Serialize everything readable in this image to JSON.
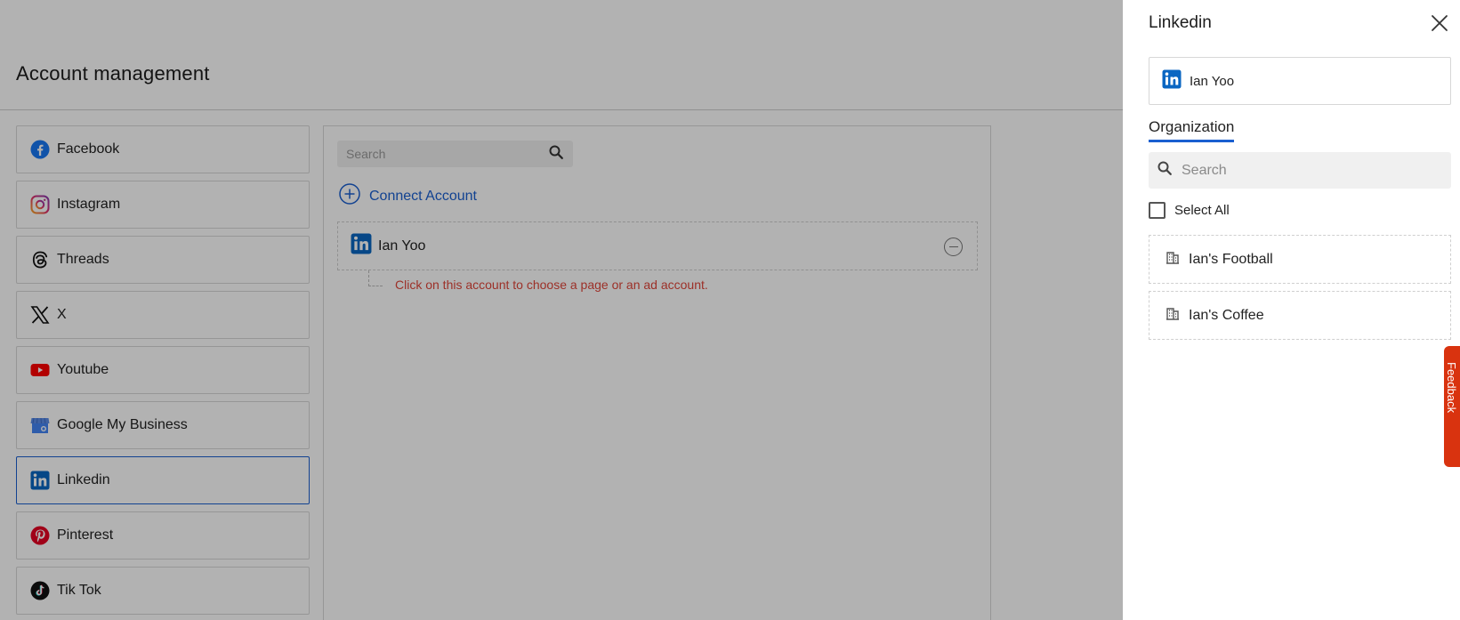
{
  "page": {
    "title": "Account management"
  },
  "platforms": [
    {
      "label": "Facebook",
      "icon": "facebook-icon"
    },
    {
      "label": "Instagram",
      "icon": "instagram-icon"
    },
    {
      "label": "Threads",
      "icon": "threads-icon"
    },
    {
      "label": "X",
      "icon": "x-icon"
    },
    {
      "label": "Youtube",
      "icon": "youtube-icon"
    },
    {
      "label": "Google My Business",
      "icon": "google-my-business-icon"
    },
    {
      "label": "Linkedin",
      "icon": "linkedin-icon",
      "active": true
    },
    {
      "label": "Pinterest",
      "icon": "pinterest-icon"
    },
    {
      "label": "Tik Tok",
      "icon": "tiktok-icon"
    }
  ],
  "main": {
    "search_placeholder": "Search",
    "connect_label": "Connect Account",
    "account_name": "Ian Yoo",
    "hint": "Click on this account to choose a page or an ad account."
  },
  "drawer": {
    "title": "Linkedin",
    "selected_account": "Ian Yoo",
    "tab_label": "Organization",
    "search_placeholder": "Search",
    "select_all_label": "Select All",
    "organizations": [
      {
        "name": "Ian's Football"
      },
      {
        "name": "Ian's Coffee"
      }
    ]
  },
  "feedback": {
    "label": "Feedback"
  },
  "colors": {
    "accent": "#1a5fd0",
    "hint": "#e0463a",
    "feedback": "#d9330f",
    "linkedin": "#0a66c2"
  }
}
